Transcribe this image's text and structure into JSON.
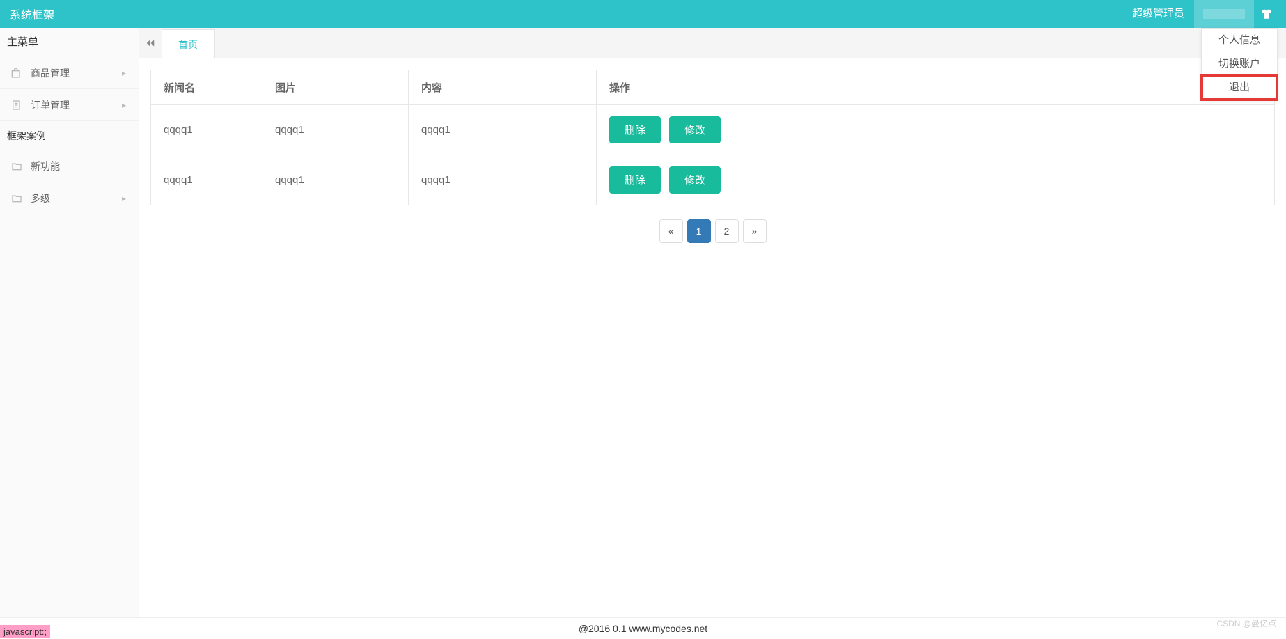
{
  "header": {
    "title": "系统框架",
    "admin_label": "超级管理员"
  },
  "dropdown": {
    "items": [
      {
        "label": "个人信息"
      },
      {
        "label": "切换账户"
      },
      {
        "label": "退出"
      }
    ]
  },
  "sidebar": {
    "main_title": "主菜单",
    "section_title": "框架案例",
    "group1": [
      {
        "label": "商品管理",
        "icon": "bag"
      },
      {
        "label": "订单管理",
        "icon": "doc"
      }
    ],
    "group2": [
      {
        "label": "新功能",
        "icon": "folder"
      },
      {
        "label": "多级",
        "icon": "folder"
      }
    ]
  },
  "tabs": {
    "home": "首页"
  },
  "table": {
    "headers": {
      "name": "新闻名",
      "image": "图片",
      "content": "内容",
      "action": "操作"
    },
    "rows": [
      {
        "name": "qqqq1",
        "image": "qqqq1",
        "content": "qqqq1"
      },
      {
        "name": "qqqq1",
        "image": "qqqq1",
        "content": "qqqq1"
      }
    ],
    "btn_delete": "删除",
    "btn_edit": "修改"
  },
  "pagination": {
    "prev": "«",
    "pages": [
      "1",
      "2"
    ],
    "next": "»",
    "active": "1"
  },
  "footer": {
    "text": "@2016 0.1 www.mycodes.net",
    "watermark": "CSDN @曼亿点"
  },
  "misc": {
    "js_corner": "javascript:;"
  }
}
